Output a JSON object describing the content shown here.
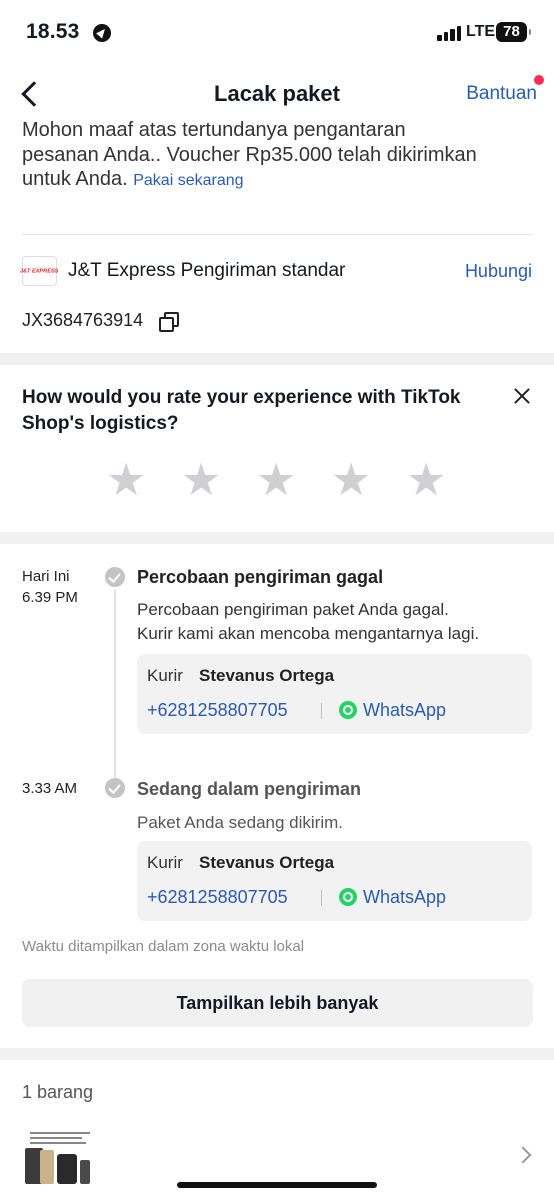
{
  "status_bar": {
    "time": "18.53",
    "network": "LTE",
    "battery": "78"
  },
  "header": {
    "title": "Lacak paket",
    "help_label": "Bantuan"
  },
  "notice": {
    "line1": "Mohon maaf atas tertundanya pengantaran",
    "line2": "pesanan Anda.. Voucher Rp35.000 telah dikirimkan",
    "line3": "untuk Anda.",
    "link": "Pakai sekarang"
  },
  "carrier": {
    "logo_text": "J&T EXPRESS",
    "name": "J&T Express Pengiriman standar",
    "contact_label": "Hubungi",
    "tracking_number": "JX3684763914"
  },
  "rating": {
    "question": "How would you rate your experience with TikTok Shop's logistics?",
    "star_count": 5,
    "selected": 0
  },
  "timeline": [
    {
      "date": "Hari Ini",
      "time": "6.39 PM",
      "title": "Percobaan pengiriman gagal",
      "desc1": "Percobaan pengiriman paket Anda gagal.",
      "desc2": "Kurir kami akan mencoba mengantarnya lagi.",
      "courier_label": "Kurir",
      "courier_name": "Stevanus Ortega",
      "courier_phone": "+6281258807705",
      "whatsapp_label": "WhatsApp"
    },
    {
      "date": "",
      "time": "3.33 AM",
      "title": "Sedang dalam pengiriman",
      "desc1": "Paket Anda sedang dikirim.",
      "desc2": "",
      "courier_label": "Kurir",
      "courier_name": "Stevanus Ortega",
      "courier_phone": "+6281258807705",
      "whatsapp_label": "WhatsApp"
    }
  ],
  "timezone_note": "Waktu ditampilkan dalam zona waktu lokal",
  "show_more_label": "Tampilkan lebih banyak",
  "items": {
    "count_label": "1 barang"
  }
}
